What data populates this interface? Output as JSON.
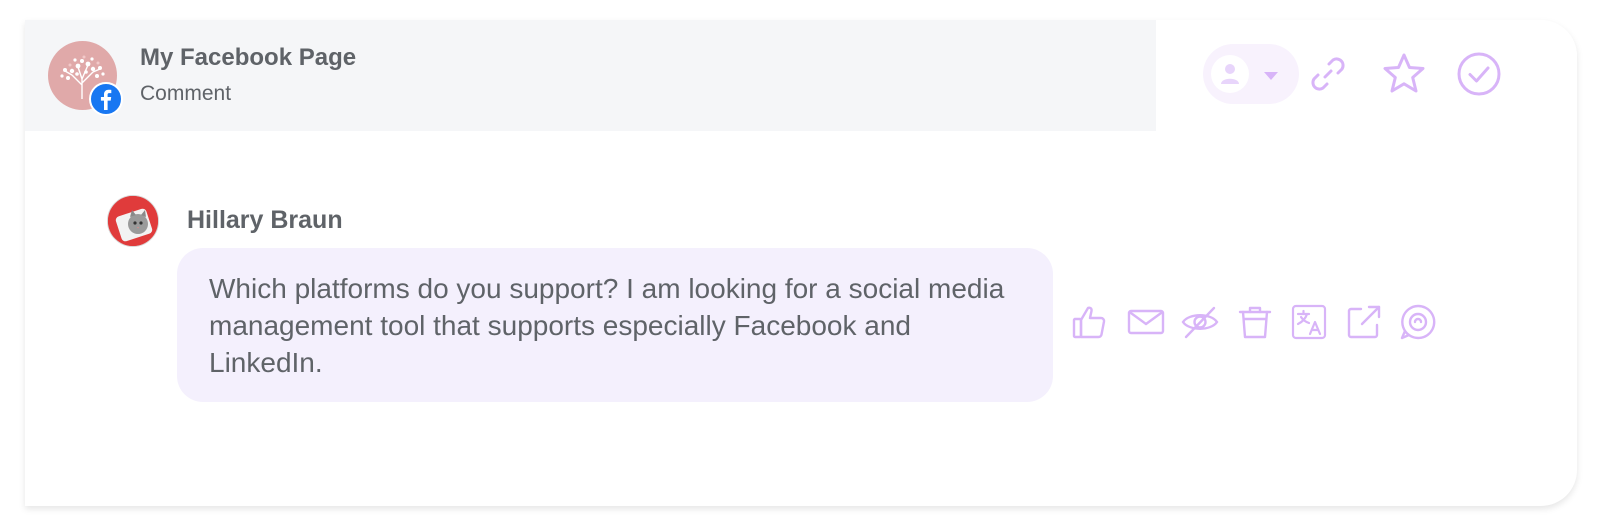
{
  "header": {
    "page_name": "My Facebook Page",
    "post_type": "Comment",
    "network_icon": "facebook-icon",
    "page_avatar_icon": "tree-logo-icon"
  },
  "header_actions": [
    {
      "name": "assign-user-dropdown",
      "icon": "user-icon"
    },
    {
      "name": "copy-link",
      "icon": "link-icon"
    },
    {
      "name": "favorite",
      "icon": "star-icon"
    },
    {
      "name": "mark-done",
      "icon": "check-circle-icon"
    }
  ],
  "message": {
    "author": "Hillary Braun",
    "author_avatar_icon": "cat-avatar",
    "text": "Which platforms do you support? I am looking for a social media management tool that supports especially Facebook and LinkedIn."
  },
  "message_actions": [
    {
      "name": "like",
      "icon": "thumbs-up-icon"
    },
    {
      "name": "private-reply",
      "icon": "envelope-icon"
    },
    {
      "name": "hide",
      "icon": "eye-off-icon"
    },
    {
      "name": "delete",
      "icon": "trash-icon"
    },
    {
      "name": "translate",
      "icon": "translate-icon"
    },
    {
      "name": "open-external",
      "icon": "external-link-icon"
    },
    {
      "name": "reply",
      "icon": "reply-bubble-icon"
    }
  ],
  "colors": {
    "accent": "#d8b4f8",
    "bubble": "#f4f0fd",
    "header_band": "#f5f6f8",
    "text": "#5f6368",
    "facebook_blue": "#1877f2"
  }
}
